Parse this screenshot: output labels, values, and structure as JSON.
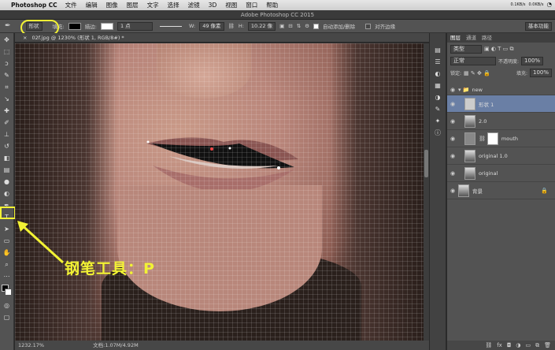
{
  "menubar": {
    "app": "Photoshop CC",
    "items": [
      "文件",
      "编辑",
      "图像",
      "图层",
      "文字",
      "选择",
      "滤镜",
      "3D",
      "视图",
      "窗口",
      "帮助"
    ],
    "net_up": "0.1KB/s",
    "net_down": "0.0KB/s"
  },
  "window": {
    "title": "Adobe Photoshop CC 2015"
  },
  "options": {
    "mode": "形状",
    "fill_label": "填充:",
    "stroke_label": "描边:",
    "stroke_width": "1 点",
    "w_label": "W:",
    "w_value": "49 像素",
    "h_label": "H:",
    "h_value": "10.22 像",
    "auto_add": "自动添加/删除",
    "align_edges": "对齐边缘",
    "workspace": "基本功能"
  },
  "document": {
    "tab": "02f.jpg @ 1230% (形状 1, RGB/8#) *",
    "zoom": "1232.17%",
    "docinfo": "文档:1.07M/4.92M"
  },
  "layers": {
    "tabs": [
      "图层",
      "通道",
      "路径"
    ],
    "kind": "类型",
    "blend": "正常",
    "opacity_label": "不透明度:",
    "opacity": "100%",
    "lock_label": "锁定:",
    "fill_label": "填充:",
    "fill": "100%",
    "items": [
      {
        "name": "new",
        "type": "group"
      },
      {
        "name": "形状 1",
        "type": "shape",
        "selected": true
      },
      {
        "name": "2.0",
        "type": "image"
      },
      {
        "name": "mouth",
        "type": "masked"
      },
      {
        "name": "original 1.0",
        "type": "image"
      },
      {
        "name": "original",
        "type": "image"
      },
      {
        "name": "背景",
        "type": "background"
      }
    ]
  },
  "annotation": {
    "text": "钢笔工具：P",
    "color": "#f2f234"
  }
}
